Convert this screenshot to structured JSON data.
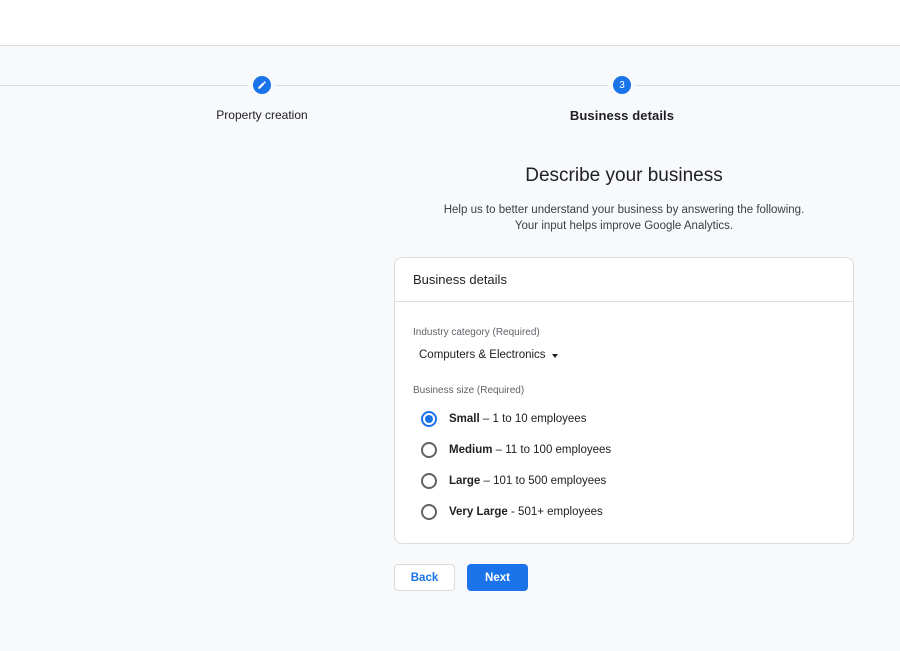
{
  "stepper": {
    "steps": [
      {
        "label": "Property creation",
        "state": "completed",
        "icon": "pencil-icon"
      },
      {
        "label": "Business details",
        "state": "active",
        "number": "3"
      }
    ]
  },
  "main": {
    "title": "Describe your business",
    "subtitle_line1": "Help us to better understand your business by answering the following.",
    "subtitle_line2": "Your input helps improve Google Analytics."
  },
  "card": {
    "header": "Business details",
    "industry": {
      "label": "Industry category (Required)",
      "selected": "Computers & Electronics"
    },
    "size": {
      "label": "Business size (Required)",
      "options": [
        {
          "name": "Small",
          "detail": " – 1 to 10 employees",
          "checked": true
        },
        {
          "name": "Medium",
          "detail": " – 11 to 100 employees",
          "checked": false
        },
        {
          "name": "Large",
          "detail": " – 101 to 500 employees",
          "checked": false
        },
        {
          "name": "Very Large",
          "detail": " - 501+ employees",
          "checked": false
        }
      ]
    }
  },
  "actions": {
    "back_label": "Back",
    "next_label": "Next"
  },
  "colors": {
    "accent": "#1a73e8",
    "background": "#f8f9fa",
    "border": "#dadce0"
  }
}
